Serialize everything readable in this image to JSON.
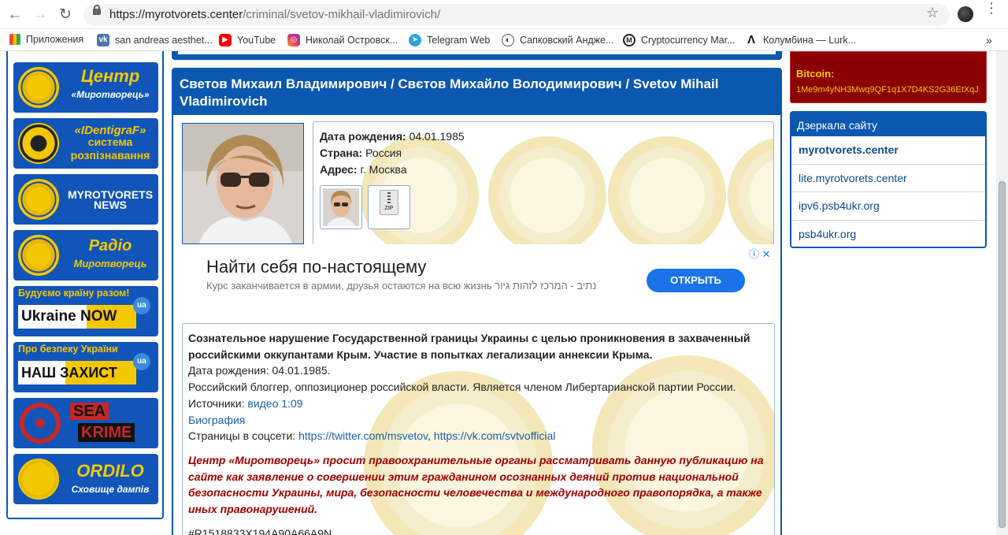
{
  "browser": {
    "url_host": "https://myrotvorets.center",
    "url_path": "/criminal/svetov-mikhail-vladimirovich/",
    "bookmarks": [
      {
        "label": "Приложения",
        "icon": "apps-grid-icon"
      },
      {
        "label": "san andreas aesthet...",
        "icon": "vk-icon"
      },
      {
        "label": "YouTube",
        "icon": "youtube-icon"
      },
      {
        "label": "Николай Островск...",
        "icon": "instagram-icon"
      },
      {
        "label": "Telegram Web",
        "icon": "telegram-icon"
      },
      {
        "label": "Сапковский Андже...",
        "icon": "moon-icon"
      },
      {
        "label": "Cryptocurrency Mar...",
        "icon": "coinmarketcap-icon"
      },
      {
        "label": "Колумбина — Lurk...",
        "icon": "lambda-icon"
      }
    ],
    "more": "»"
  },
  "sidebar": {
    "banners": [
      {
        "line1": "Центр",
        "line2": "«Миротворець»"
      },
      {
        "line1": "«IDentigraF»",
        "line2": "система розпізнавання"
      },
      {
        "line1": "MYROTVORETS",
        "line2": "NEWS"
      },
      {
        "line1": "Радіо",
        "line2": "Миротворець"
      },
      {
        "line1": "Будуємо країну разом!",
        "line2": "Ukraine NOW",
        "badge": "ua"
      },
      {
        "line1": "Про безпеку України",
        "line2": "НАШ ЗАХИСТ",
        "badge": "ua"
      },
      {
        "line1": "SEA",
        "line2": "KRIME"
      },
      {
        "line1": "ORDILO",
        "line2": "Сховище дампів"
      }
    ]
  },
  "main": {
    "title": "Светов Михаил Владимирович / Свєтов Михайло Володимирович / Svetov Mihail Vladimirovich",
    "info": {
      "dob_label": "Дата рождения:",
      "dob_value": "04.01.1985",
      "country_label": "Страна:",
      "country_value": "Россия",
      "address_label": "Адрес:",
      "address_value": "г. Москва",
      "zip_label": "ZIP"
    },
    "ad": {
      "headline": "Найти себя по-настоящему",
      "text": "Курс заканчивается в армии, друзья остаются на всю жизнь נתיב - המרכז לזהות גיור",
      "button": "ОТКРЫТЬ",
      "icons": "ⓘ ✕"
    },
    "desc": {
      "lead": "Сознательное нарушение Государственной границы Украины с целью проникновения в захваченный российскими оккупантами Крым. Участие в попытках легализации аннексии Крыма.",
      "dob": "Дата рождения: 04.01.1985.",
      "bio": "Российский блоггер, оппозиционер российской власти. Является членом Либертарианской партии России.",
      "sources_label": "Источники:",
      "sources_link": "видео 1:09",
      "bio_link": "Биография",
      "social_label": "Страницы в соцсети:",
      "social_link1": "https://twitter.com/msvetov",
      "social_sep": ",",
      "social_link2": "https://vk.com/svtvofficial",
      "warning": "Центр «Миротворець» просит правоохранительные органы рассматривать данную публикацию на сайте как заявление о совершении этим гражданином осознанных деяний против национальной безопасности Украины, мира, безопасности человечества и международного правопорядка, а также иных правонарушений.",
      "hash": "#R1518833X194A90A66A9N"
    }
  },
  "right": {
    "bitcoin_label": "Bitcoin:",
    "bitcoin_address": "1Me9m4yNH3Mwq9QF1q1X7D4KS2G36EtXqJ",
    "mirrors_title": "Дзеркала сайту",
    "mirrors": [
      "myrotvorets.center",
      "lite.myrotvorets.center",
      "ipv6.psb4ukr.org",
      "psb4ukr.org"
    ]
  }
}
